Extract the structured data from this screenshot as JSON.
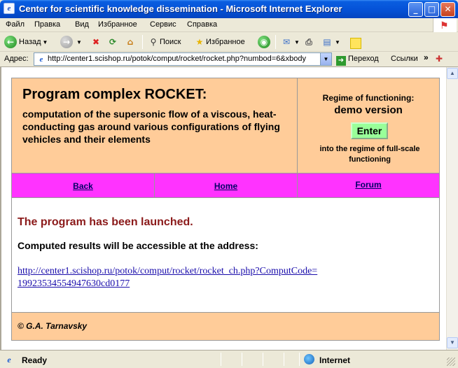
{
  "window": {
    "title": "Center for scientific knowledge dissemination  -  Microsoft Internet Explorer",
    "minimize": "_",
    "maximize": "□",
    "close": "✕"
  },
  "menu": {
    "items": [
      "Файл",
      "Правка",
      "Вид",
      "Избранное",
      "Сервис",
      "Справка"
    ]
  },
  "toolbar": {
    "back_label": "Назад",
    "search_label": "Поиск",
    "favorites_label": "Избранное"
  },
  "address": {
    "label": "Адрес:",
    "url": "http://center1.scishop.ru/potok/comput/rocket/rocket.php?numbod=6&xbody",
    "go_label": "Переход",
    "links_label": "Ссылки",
    "links_chevron": "»"
  },
  "page": {
    "title": "Program complex ROCKET:",
    "subtitle": "computation of the supersonic flow of a viscous, heat-conducting gas around various configurations of flying vehicles and their elements",
    "regime_label": "Regime of functioning:",
    "regime_value": "demo version",
    "enter_button": "Enter",
    "into_regime": "into the regime of full-scale functioning",
    "nav": {
      "back": "Back",
      "home": "Home",
      "forum": "Forum"
    },
    "launched": "The program has been launched.",
    "computed": "Computed results will be accessible at the address:",
    "result_link": "http://center1.scishop.ru/potok/comput/rocket/rocket_ch.php?ComputCode=19923534554947630cd0177",
    "footer": "©  G.A. Tarnavsky"
  },
  "status": {
    "text": "Ready",
    "zone": "Internet"
  }
}
